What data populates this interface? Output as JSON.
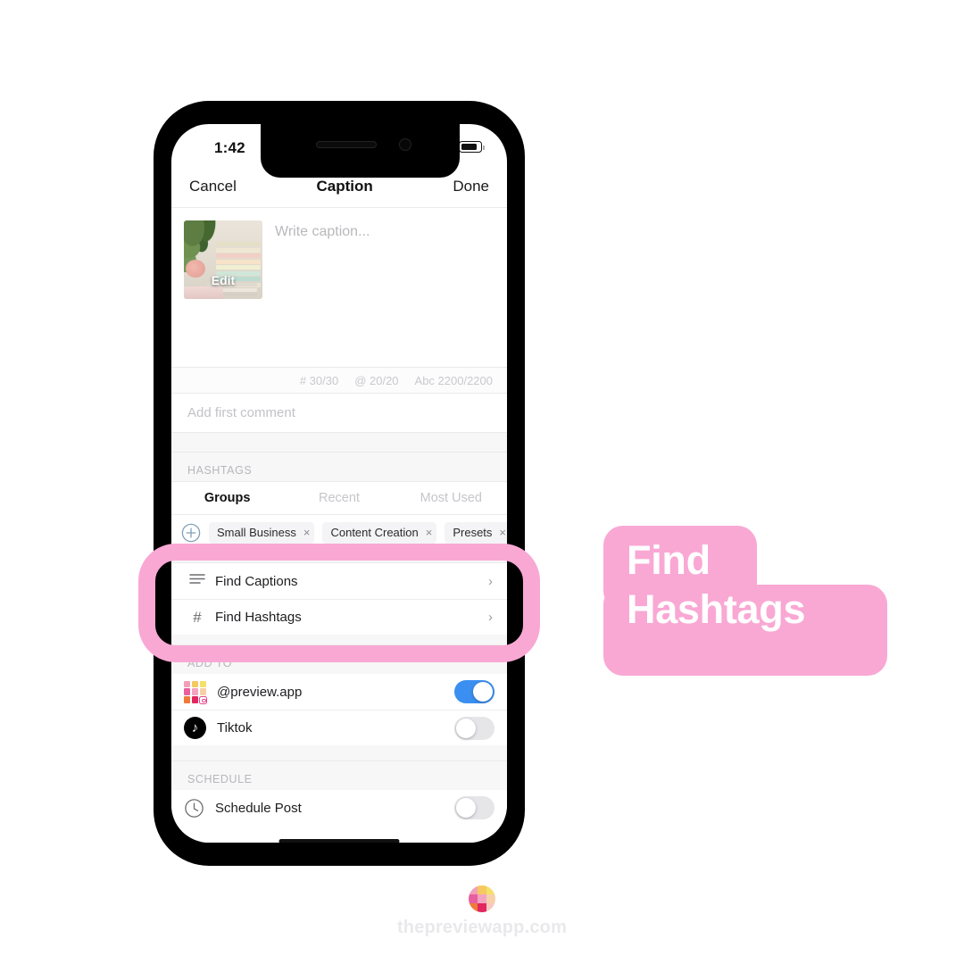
{
  "statusbar": {
    "time": "1:42",
    "wifi_icon": "wifi-icon",
    "battery_icon": "battery-icon"
  },
  "navbar": {
    "cancel": "Cancel",
    "title": "Caption",
    "done": "Done"
  },
  "caption": {
    "thumbnail_edit_label": "Edit",
    "placeholder": "Write caption...",
    "counters": [
      "# 30/30",
      "@ 20/20",
      "Abc 2200/2200"
    ]
  },
  "first_comment": {
    "placeholder": "Add first comment"
  },
  "hashtags": {
    "section_label": "HASHTAGS",
    "tabs": [
      {
        "label": "Groups",
        "active": true
      },
      {
        "label": "Recent",
        "active": false
      },
      {
        "label": "Most Used",
        "active": false
      }
    ],
    "add_icon": "plus-circle-icon",
    "chips": [
      {
        "label": "Small Business",
        "remove": "×"
      },
      {
        "label": "Content Creation",
        "remove": "×"
      },
      {
        "label": "Presets",
        "remove": "×"
      }
    ]
  },
  "find_rows": [
    {
      "icon": "lines-icon",
      "glyph": "☰",
      "label": "Find Captions",
      "chevron": "›"
    },
    {
      "icon": "hash-icon",
      "glyph": "#",
      "label": "Find Hashtags",
      "chevron": "›"
    }
  ],
  "add_to": {
    "section_label": "ADD TO",
    "accounts": [
      {
        "icon": "instagram-grid-icon",
        "label": "@preview.app",
        "toggle": "on"
      },
      {
        "icon": "tiktok-icon",
        "label": "Tiktok",
        "toggle": "off"
      }
    ]
  },
  "schedule": {
    "section_label": "SCHEDULE",
    "rows": [
      {
        "icon": "clock-icon",
        "label": "Schedule Post",
        "toggle": "off"
      }
    ]
  },
  "callout": {
    "line1": "Find",
    "line2": "Hashtags"
  },
  "footer": {
    "logo_icon": "preview-app-logo",
    "url": "thepreviewapp.com"
  },
  "colors": {
    "pink": "#f9a8d4",
    "toggle_on": "#3b8ff0",
    "toggle_off": "#e6e6e9",
    "text": "#1d1d20",
    "muted": "#b7b7bc"
  }
}
